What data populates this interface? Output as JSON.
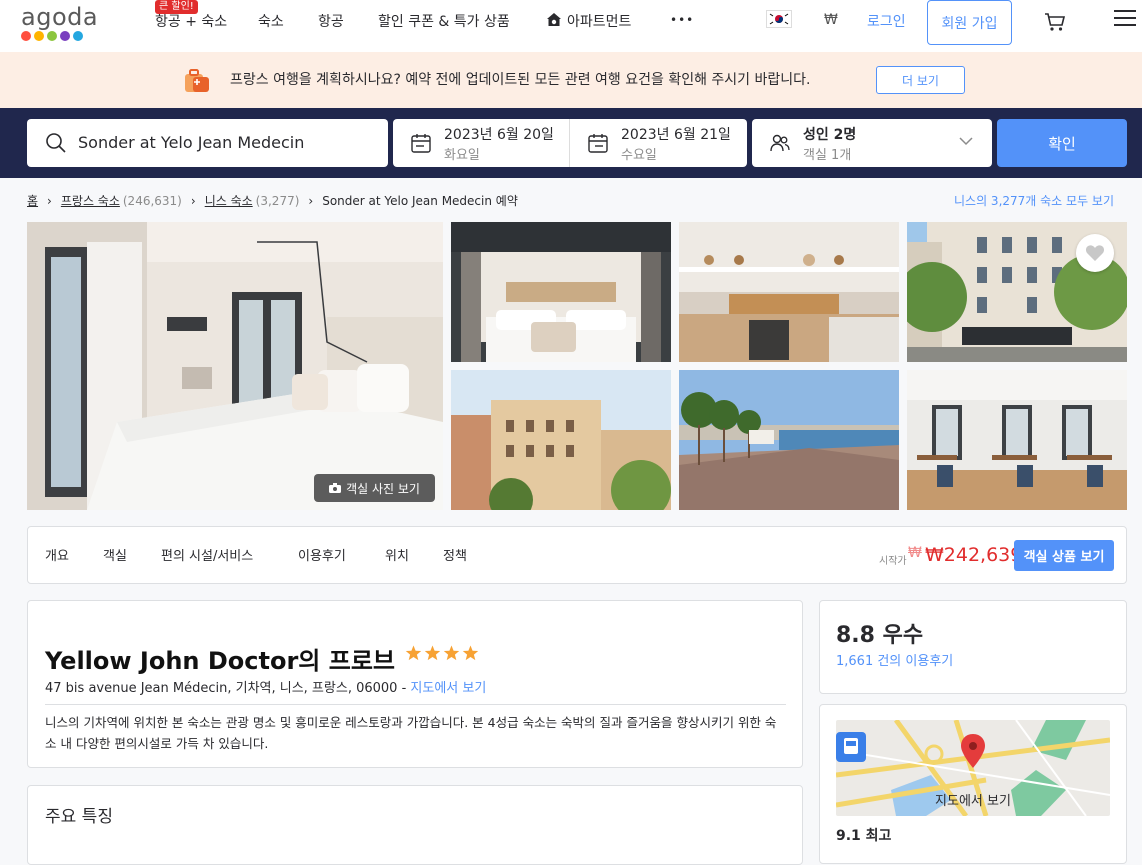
{
  "brand": {
    "logo_text": "agoda",
    "dot_colors": [
      "#ff4f3f",
      "#ffb400",
      "#8cc63e",
      "#7a3fbf",
      "#24a7e0"
    ]
  },
  "nav": {
    "sale_badge": "큰 할인!",
    "items": [
      "항공 + 숙소",
      "숙소",
      "항공",
      "할인 쿠폰 & 특가 상품",
      "아파트먼트"
    ],
    "more": "•••",
    "currency": "₩",
    "login": "로그인",
    "signup": "회원 가입"
  },
  "banner": {
    "text": "프랑스 여행을 계획하시나요? 예약 전에 업데이트된 모든 관련 여행 요건을 확인해 주시기 바랍니다.",
    "button": "더 보기"
  },
  "search": {
    "destination": "Sonder at Yelo Jean Medecin",
    "checkin_date": "2023년 6월 20일",
    "checkin_day": "화요일",
    "checkout_date": "2023년 6월 21일",
    "checkout_day": "수요일",
    "guests": "성인 2명",
    "rooms": "객실 1개",
    "confirm": "확인"
  },
  "breadcrumb": {
    "home": "홈",
    "country": "프랑스 숙소",
    "country_count": "(246,631)",
    "city": "니스 숙소",
    "city_count": "(3,277)",
    "current": "Sonder at Yelo Jean Medecin 예약",
    "all_link": "니스의 3,277개 숙소 모두 보기"
  },
  "gallery": {
    "room_photos_button": "객실 사진 보기"
  },
  "tabs": {
    "items": [
      "개요",
      "객실",
      "편의 시설/서비스",
      "이용후기",
      "위치",
      "정책"
    ],
    "price_from": "시작가",
    "price_old": "₩",
    "price": "₩242,639",
    "view_rooms": "객실 상품 보기"
  },
  "hotel": {
    "name": "Yellow John Doctor의 프로브",
    "star_rating": 4,
    "address": "47 bis avenue Jean Médecin, 기차역, 니스, 프랑스, 06000 - ",
    "map_link": "지도에서 보기",
    "description": "니스의 기차역에 위치한 본 숙소는 관광 명소 및 흥미로운 레스토랑과 가깝습니다. 본 4성급 숙소는 숙박의 질과 즐거움을 향상시키기 위한 숙소 내 다양한 편의시설로 가득 차 있습니다."
  },
  "features": {
    "title": "주요 특징"
  },
  "rating": {
    "score": "8.8 우수",
    "reviews": "1,661 건의 이용후기"
  },
  "map": {
    "label": "지도에서 보기",
    "location_score": "9.1 최고"
  }
}
